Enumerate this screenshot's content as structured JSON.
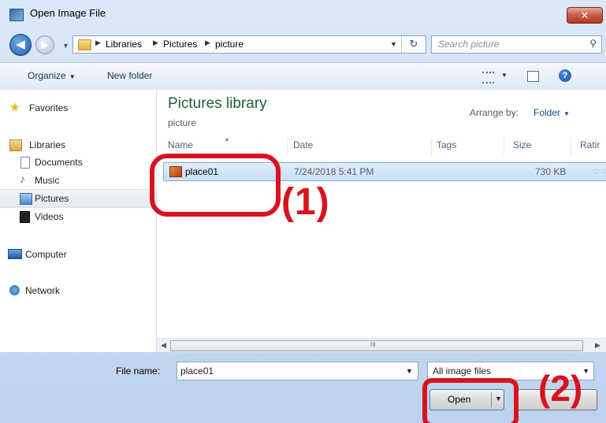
{
  "window": {
    "title": "Open Image File",
    "close_glyph": "✕"
  },
  "address": {
    "back_glyph": "◀",
    "forward_glyph": "▶",
    "crumbs": [
      "Libraries",
      "Pictures",
      "picture"
    ],
    "refresh_glyph": "↻",
    "search_placeholder": "Search picture"
  },
  "toolbar": {
    "organize_label": "Organize",
    "new_folder_label": "New folder",
    "help_glyph": "?"
  },
  "nav": {
    "favorites": "Favorites",
    "libraries": "Libraries",
    "documents": "Documents",
    "music": "Music",
    "pictures": "Pictures",
    "videos": "Videos",
    "computer": "Computer",
    "network": "Network"
  },
  "content": {
    "library_title": "Pictures library",
    "library_subtitle": "picture",
    "arrange_label": "Arrange by:",
    "arrange_value": "Folder",
    "columns": [
      "Name",
      "Date",
      "Tags",
      "Size",
      "Ratir"
    ],
    "files": [
      {
        "name": "place01",
        "date": "7/24/2018 5:41 PM",
        "size": "730 KB",
        "rating": "☆☆"
      }
    ],
    "scroll_grip": "III"
  },
  "bottom": {
    "file_name_label": "File name:",
    "file_name_value": "place01",
    "filter_value": "All image files",
    "open_label": "Open"
  },
  "annotations": {
    "label1": "(1)",
    "label2": "(2)",
    "color": "#d8131f"
  }
}
